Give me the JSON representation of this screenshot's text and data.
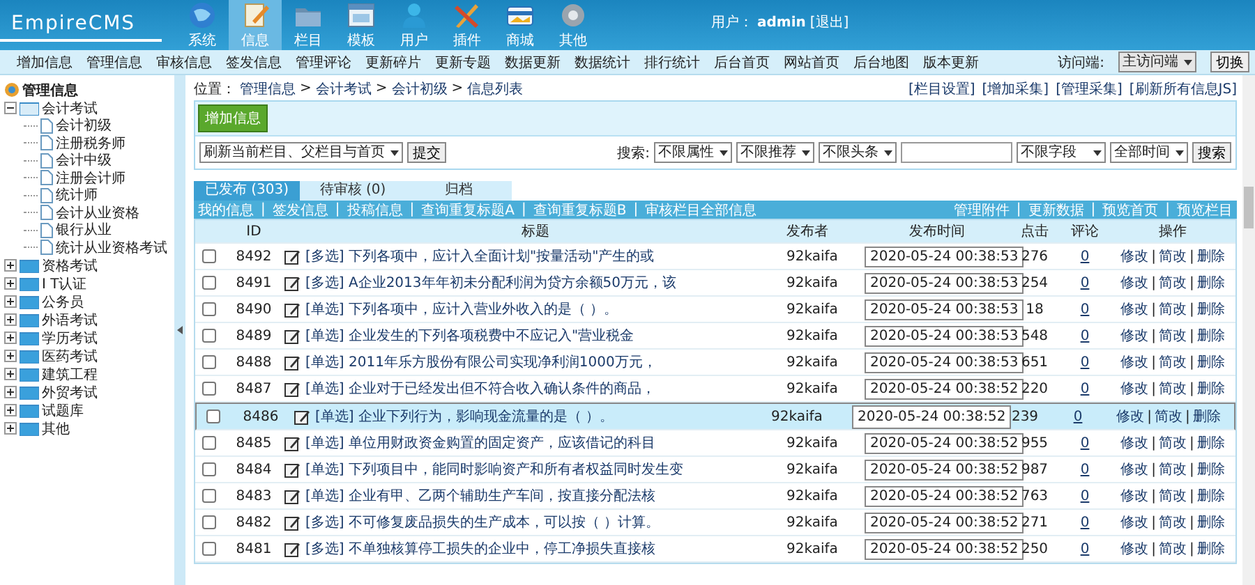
{
  "header": {
    "logo": "EmpireCMS",
    "nav": [
      {
        "label": "系统",
        "selected": false
      },
      {
        "label": "信息",
        "selected": true
      },
      {
        "label": "栏目",
        "selected": false
      },
      {
        "label": "模板",
        "selected": false
      },
      {
        "label": "用户",
        "selected": false
      },
      {
        "label": "插件",
        "selected": false
      },
      {
        "label": "商城",
        "selected": false
      },
      {
        "label": "其他",
        "selected": false
      }
    ],
    "user_label": "用户：",
    "user": "admin",
    "logout": "[退出]"
  },
  "menu": {
    "items": [
      "增加信息",
      "管理信息",
      "审核信息",
      "签发信息",
      "管理评论",
      "更新碎片",
      "更新专题",
      "数据更新",
      "数据统计",
      "排行统计",
      "后台首页",
      "网站首页",
      "后台地图",
      "版本更新"
    ],
    "access_label": "访问端:",
    "access_value": "主访问端",
    "switch_button": "切换"
  },
  "sidebar": {
    "root": "管理信息",
    "tree": [
      {
        "label": "会计考试",
        "expanded": true,
        "children": [
          {
            "label": "会计初级"
          },
          {
            "label": "注册税务师"
          },
          {
            "label": "会计中级"
          },
          {
            "label": "注册会计师"
          },
          {
            "label": "统计师"
          },
          {
            "label": "会计从业资格"
          },
          {
            "label": "银行从业"
          },
          {
            "label": "统计从业资格考试"
          }
        ]
      },
      {
        "label": "资格考试",
        "expanded": false
      },
      {
        "label": "I T认证",
        "expanded": false
      },
      {
        "label": "公务员",
        "expanded": false
      },
      {
        "label": "外语考试",
        "expanded": false
      },
      {
        "label": "学历考试",
        "expanded": false
      },
      {
        "label": "医药考试",
        "expanded": false
      },
      {
        "label": "建筑工程",
        "expanded": false
      },
      {
        "label": "外贸考试",
        "expanded": false
      },
      {
        "label": "试题库",
        "expanded": false
      },
      {
        "label": "其他",
        "expanded": false
      }
    ]
  },
  "breadcrumb": {
    "label": "位置：",
    "separator": ">",
    "items": [
      "管理信息",
      "会计考试",
      "会计初级",
      "信息列表"
    ]
  },
  "links": [
    "[栏目设置]",
    "[增加采集]",
    "[管理采集]",
    "[刷新所有信息JS]"
  ],
  "toolbar": {
    "add_button": "增加信息",
    "refresh_select": "刷新当前栏目、父栏目与首页",
    "submit_button": "提交",
    "search_label": "搜索:",
    "filters": [
      "不限属性",
      "不限推荐",
      "不限头条"
    ],
    "field_select": "不限字段",
    "time_select": "全部时间",
    "search_button": "搜索"
  },
  "tabs": [
    {
      "label": "已发布 (303)",
      "selected": true
    },
    {
      "label": "待审核 (0)",
      "selected": false
    },
    {
      "label": "归档",
      "selected": false
    }
  ],
  "subbar": {
    "separator": "|",
    "left": [
      "我的信息",
      "签发信息",
      "投稿信息",
      "查询重复标题A",
      "查询重复标题B",
      "审核栏目全部信息"
    ],
    "right": [
      "管理附件",
      "更新数据",
      "预览首页",
      "预览栏目"
    ]
  },
  "table": {
    "columns": [
      "ID",
      "标题",
      "发布者",
      "发布时间",
      "点击",
      "评论",
      "操作"
    ],
    "action_separator": "|",
    "rows": [
      {
        "checked": false,
        "selected": false,
        "id": "8492",
        "title": "[多选] 下列各项中，应计入全面计划\"按量活动\"产生的或",
        "author": "92kaifa",
        "time": "2020-05-24 00:38:53",
        "clicks": "276",
        "comments": "0",
        "actions": [
          "修改",
          "简改",
          "删除"
        ]
      },
      {
        "checked": false,
        "selected": false,
        "id": "8491",
        "title": "[多选] A企业2013年年初未分配利润为贷方余额50万元，该",
        "author": "92kaifa",
        "time": "2020-05-24 00:38:53",
        "clicks": "254",
        "comments": "0",
        "actions": [
          "修改",
          "简改",
          "删除"
        ]
      },
      {
        "checked": false,
        "selected": false,
        "id": "8490",
        "title": "[单选] 下列各项中，应计入营业外收入的是（ ）。",
        "author": "92kaifa",
        "time": "2020-05-24 00:38:53",
        "clicks": "18",
        "comments": "0",
        "actions": [
          "修改",
          "简改",
          "删除"
        ]
      },
      {
        "checked": false,
        "selected": false,
        "id": "8489",
        "title": "[单选] 企业发生的下列各项税费中不应记入\"营业税金",
        "author": "92kaifa",
        "time": "2020-05-24 00:38:53",
        "clicks": "548",
        "comments": "0",
        "actions": [
          "修改",
          "简改",
          "删除"
        ]
      },
      {
        "checked": false,
        "selected": false,
        "id": "8488",
        "title": "[单选] 2011年乐方股份有限公司实现净利润1000万元，",
        "author": "92kaifa",
        "time": "2020-05-24 00:38:53",
        "clicks": "651",
        "comments": "0",
        "actions": [
          "修改",
          "简改",
          "删除"
        ]
      },
      {
        "checked": false,
        "selected": false,
        "id": "8487",
        "title": "[单选] 企业对于已经发出但不符合收入确认条件的商品，",
        "author": "92kaifa",
        "time": "2020-05-24 00:38:52",
        "clicks": "220",
        "comments": "0",
        "actions": [
          "修改",
          "简改",
          "删除"
        ]
      },
      {
        "checked": false,
        "selected": true,
        "id": "8486",
        "title": "[单选] 企业下列行为，影响现金流量的是（ ）。",
        "author": "92kaifa",
        "time": "2020-05-24 00:38:52",
        "clicks": "239",
        "comments": "0",
        "actions": [
          "修改",
          "简改",
          "删除"
        ]
      },
      {
        "checked": false,
        "selected": false,
        "id": "8485",
        "title": "[单选] 单位用财政资金购置的固定资产，应该借记的科目",
        "author": "92kaifa",
        "time": "2020-05-24 00:38:52",
        "clicks": "955",
        "comments": "0",
        "actions": [
          "修改",
          "简改",
          "删除"
        ]
      },
      {
        "checked": false,
        "selected": false,
        "id": "8484",
        "title": "[单选] 下列项目中，能同时影响资产和所有者权益同时发生变",
        "author": "92kaifa",
        "time": "2020-05-24 00:38:52",
        "clicks": "987",
        "comments": "0",
        "actions": [
          "修改",
          "简改",
          "删除"
        ]
      },
      {
        "checked": false,
        "selected": false,
        "id": "8483",
        "title": "[单选] 企业有甲、乙两个辅助生产车间，按直接分配法核",
        "author": "92kaifa",
        "time": "2020-05-24 00:38:52",
        "clicks": "763",
        "comments": "0",
        "actions": [
          "修改",
          "简改",
          "删除"
        ]
      },
      {
        "checked": false,
        "selected": false,
        "id": "8482",
        "title": "[多选] 不可修复废品损失的生产成本，可以按（ ）计算。",
        "author": "92kaifa",
        "time": "2020-05-24 00:38:52",
        "clicks": "271",
        "comments": "0",
        "actions": [
          "修改",
          "简改",
          "删除"
        ]
      },
      {
        "checked": false,
        "selected": false,
        "id": "8481",
        "title": "[多选] 不单独核算停工损失的企业中，停工净损失直接核",
        "author": "92kaifa",
        "time": "2020-05-24 00:38:52",
        "clicks": "250",
        "comments": "0",
        "actions": [
          "修改",
          "简改",
          "删除"
        ]
      }
    ]
  }
}
